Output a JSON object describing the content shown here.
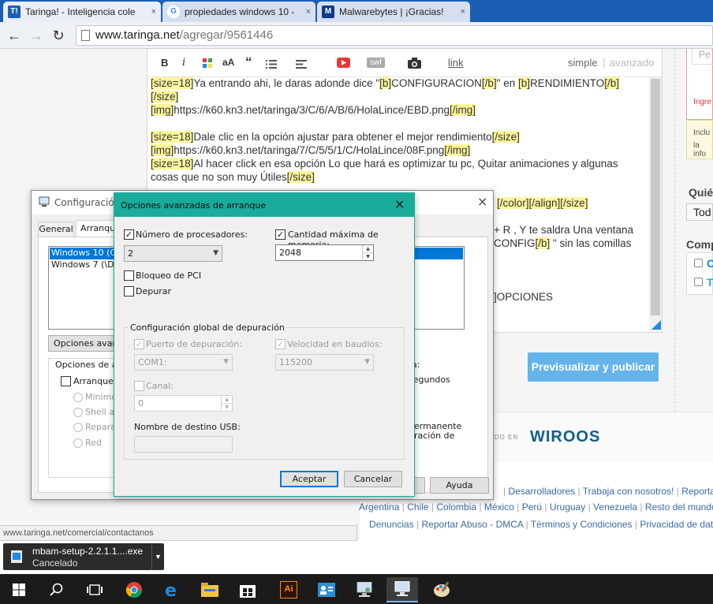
{
  "browser": {
    "tabs": [
      {
        "title": "Taringa! - Inteligencia cole",
        "favicon": "T!",
        "color": "#1a5fb4",
        "active": true
      },
      {
        "title": "propiedades windows 10 -",
        "favicon": "G",
        "color": "#4285f4",
        "active": false
      },
      {
        "title": "Malwarebytes | ¡Gracias!",
        "favicon": "M",
        "color": "#0d3c8c",
        "active": false
      }
    ],
    "url_host": "www.taringa.net",
    "url_path": "/agregar/9561446",
    "close_glyph": "×"
  },
  "editor": {
    "toolbar": {
      "bold": "B",
      "italic": "i",
      "fontsize": "aA",
      "quote": "“",
      "swf": "swf",
      "link": "link",
      "mode_simple": "simple",
      "mode_divider": "|",
      "mode_advanced": "avanzado"
    },
    "lines": [
      [
        {
          "t": "[size=18]",
          "h": true
        },
        {
          "t": "Ya entrando ahi, le daras adonde dice \""
        },
        {
          "t": "[b]",
          "h": true
        },
        {
          "t": "CONFIGURACION"
        },
        {
          "t": "[/b]",
          "h": true
        },
        {
          "t": "\" en "
        },
        {
          "t": "[b]",
          "h": true
        },
        {
          "t": "RENDIMIENTO"
        },
        {
          "t": "[/b]",
          "h": true
        }
      ],
      [
        {
          "t": "[/size]",
          "h": true
        }
      ],
      [
        {
          "t": "[img]",
          "h": true
        },
        {
          "t": "https://k60.kn3.net/taringa/3/C/6/A/B/6/HolaLince/EBD.png"
        },
        {
          "t": "[/img]",
          "h": true
        }
      ],
      [
        {
          "t": ""
        }
      ],
      [
        {
          "t": "[size=18]",
          "h": true
        },
        {
          "t": "Dale clic en la opción ajustar para obtener el mejor rendimiento"
        },
        {
          "t": "[/size]",
          "h": true
        }
      ],
      [
        {
          "t": "[img]",
          "h": true
        },
        {
          "t": "https://k60.kn3.net/taringa/7/C/5/5/1/C/HolaLince/08F.png"
        },
        {
          "t": "[/img]",
          "h": true
        }
      ],
      [
        {
          "t": "[size=18]",
          "h": true
        },
        {
          "t": "Al hacer click en esa opción Lo que hará es optimizar tu pc, Quitar animaciones y algunas"
        }
      ],
      [
        {
          "t": "cosas que no son muy Útiles"
        },
        {
          "t": "[/size]",
          "h": true
        }
      ]
    ],
    "visible_fragments": {
      "frag1": "[/color][/align][/size]",
      "frag2": "+ R , Y te saldra Una ventana",
      "frag3": "CONFIG",
      "frag3b": "[/b]",
      "frag3c": " \" sin las comillas",
      "frag4": "]OPCIONES"
    },
    "publish_button": "Previsualizar y publicar"
  },
  "sidebar": {
    "error_text": "Ingre",
    "input_placeholder": "Pe",
    "info_text1": "Inclu",
    "info_text2": "la info",
    "who_label": "Quié",
    "who_select": "Tod",
    "comp_label": "Comp",
    "opt1": "C",
    "opt2": "T"
  },
  "footer": {
    "wiroos_small": "RDO EN",
    "wiroos": "WIROOS",
    "row1": [
      "Desarrolladores",
      "Trabaja con nosotros!",
      "Reportar bu"
    ],
    "row2": [
      "Argentina",
      "Chile",
      "Colombia",
      "México",
      "Perú",
      "Uruguay",
      "Venezuela",
      "Resto del mundo"
    ],
    "row3": [
      "Denuncias",
      "Reportar Abuso - DMCA",
      "Términos y Condiciones",
      "Privacidad de datos"
    ]
  },
  "msconfig": {
    "title": "Configuración",
    "tabs": [
      "General",
      "Arranque"
    ],
    "os_list": [
      "Windows 10 (C:\\",
      "Windows 7 (\\Dev"
    ],
    "advanced_btn": "Opciones avanz",
    "boot_options_label": "Opciones de arr",
    "safe_boot": "Arranque a",
    "radios": [
      "Mínimo",
      "Shell alt",
      "Reparar",
      "Red"
    ],
    "right_text1": "a:",
    "right_text2": "segundos",
    "right_text3": "permanente",
    "right_text4": "uración de",
    "help_btn": "Ayuda"
  },
  "advanced_dialog": {
    "title": "Opciones avanzadas de arranque",
    "accent": "#1aab9b",
    "num_processors_label": "Número de procesadores:",
    "num_processors_checked": true,
    "num_processors_value": "2",
    "max_memory_label": "Cantidad máxima de memoria:",
    "max_memory_checked": true,
    "max_memory_value": "2048",
    "pci_lock_label": "Bloqueo de PCI",
    "debug_label": "Depurar",
    "global_debug_group": "Configuración global de depuración",
    "debug_port_label": "Puerto de depuración:",
    "debug_port_value": "COM1:",
    "baud_label": "Velocidad en baudios:",
    "baud_value": "115200",
    "channel_label": "Canal:",
    "channel_value": "0",
    "usb_target_label": "Nombre de destino USB:",
    "ok_btn": "Aceptar",
    "cancel_btn": "Cancelar",
    "check_glyph": "✓"
  },
  "status_url": "www.taringa.net/comercial/contactanos",
  "download": {
    "filename": "mbam-setup-2.2.1.1....exe",
    "status": "Cancelado"
  },
  "taskbar": {
    "icons": [
      "windows-start-icon",
      "search-icon",
      "task-view-icon",
      "chrome-icon",
      "edge-icon",
      "file-explorer-icon",
      "store-icon",
      "illustrator-icon",
      "contacts-icon",
      "system-config-icon",
      "msconfig-icon",
      "paint-icon"
    ],
    "illustrator_label": "Ai"
  }
}
